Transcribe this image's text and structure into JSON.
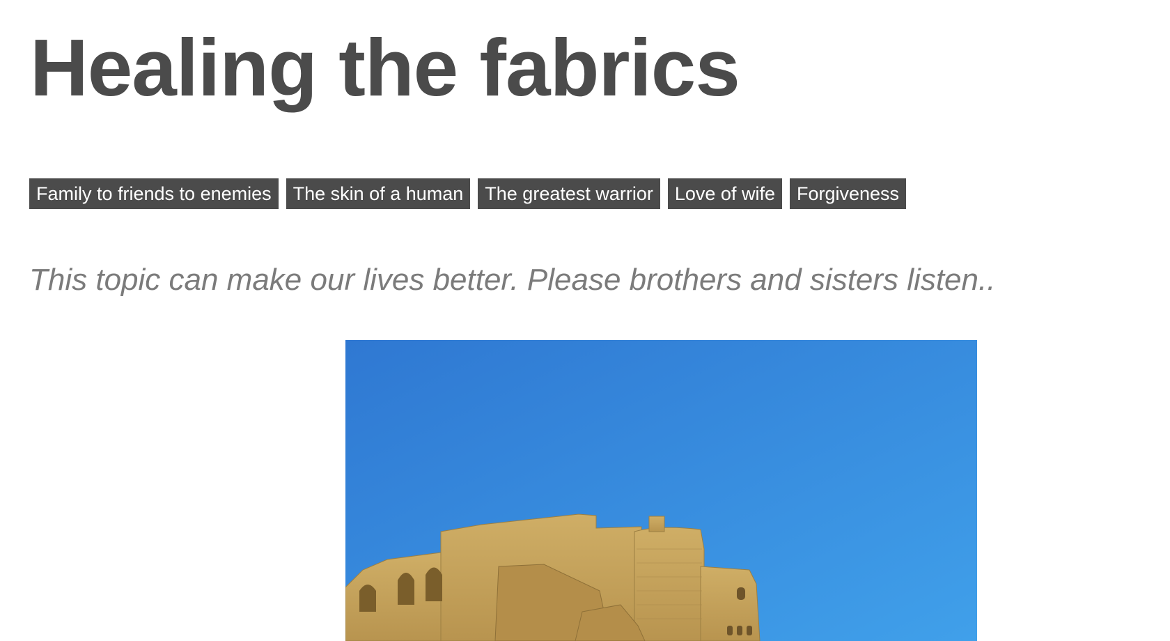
{
  "page": {
    "title": "Healing the fabrics",
    "subtitle": "This topic can make our lives better. Please brothers and sisters listen.."
  },
  "tags": [
    {
      "label": "Family to friends to enemies"
    },
    {
      "label": "The skin of a human"
    },
    {
      "label": "The greatest warrior"
    },
    {
      "label": "Love of wife"
    },
    {
      "label": "Forgiveness"
    }
  ],
  "hero_image": {
    "subject": "fortress-photo",
    "colors": {
      "sky": "#3a8de0",
      "fortress": "#c8a65e",
      "shadow": "#9c7f42"
    }
  }
}
